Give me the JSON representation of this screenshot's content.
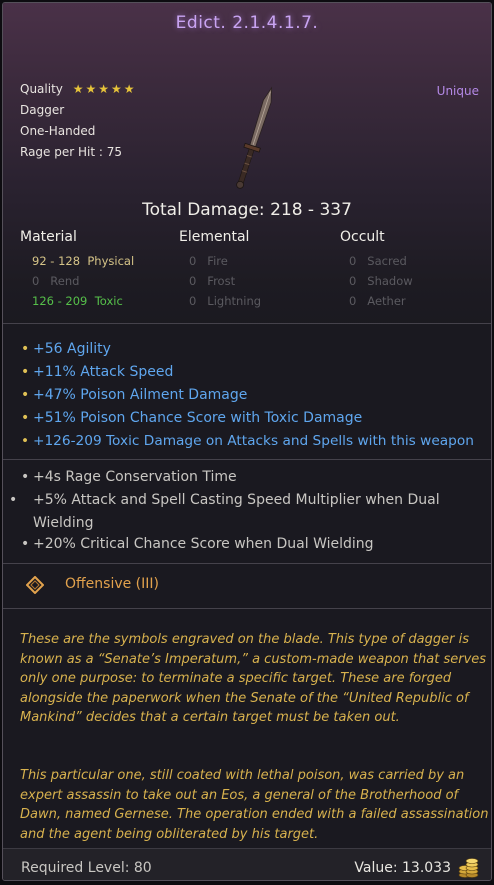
{
  "item": {
    "name": "Edict. 2.1.4.1.7.",
    "rarity": "Unique",
    "quality_label": "Quality",
    "quality_stars": "★★★★★",
    "type": "Dagger",
    "handedness": "One-Handed",
    "rage_per_hit": "Rage per Hit : 75",
    "total_damage": "Total Damage: 218 - 337"
  },
  "damage_table": {
    "headers": [
      "Material",
      "Elemental",
      "Occult"
    ],
    "rows": [
      [
        {
          "range": "92 - 128",
          "type": "Physical"
        },
        {
          "range": "0",
          "type": "Fire"
        },
        {
          "range": "0",
          "type": "Sacred"
        }
      ],
      [
        {
          "range": "0",
          "type": "Rend"
        },
        {
          "range": "0",
          "type": "Frost"
        },
        {
          "range": "0",
          "type": "Shadow"
        }
      ],
      [
        {
          "range": "126 - 209",
          "type": "Toxic"
        },
        {
          "range": "0",
          "type": "Lightning"
        },
        {
          "range": "0",
          "type": "Aether"
        }
      ]
    ]
  },
  "primary_mods": [
    "+56 Agility",
    "+11% Attack Speed",
    "+47% Poison Ailment Damage",
    "+51% Poison Chance Score with Toxic Damage",
    "+126-209 Toxic Damage on Attacks and Spells with this weapon"
  ],
  "secondary_mods": [
    "+4s Rage Conservation Time",
    "+5% Attack and Spell Casting Speed Multiplier when Dual Wielding",
    "+20% Critical Chance Score when Dual Wielding"
  ],
  "affix_category": "Offensive (III)",
  "lore": [
    "These are the symbols engraved on the blade. This type of dagger is known as a “Senate’s Imperatum,” a custom-made weapon that serves only one purpose: to terminate a specific target. These are forged alongside the paperwork when the Senate of the “United Republic of Mankind” decides that a certain target must be taken out.",
    "This particular one, still coated with lethal poison, was carried by an expert assassin to take out an Eos, a general of the Brotherhood of Dawn, named Gernese. The operation ended with a failed assassination and the agent being obliterated by his target."
  ],
  "footer": {
    "required_level": "Required Level: 80",
    "value": "Value: 13.033"
  },
  "icons": [
    "dagger-icon",
    "diamond-icon",
    "coin-stack-icon",
    "bullet-icon"
  ],
  "colors": {
    "title": "#c9a4f2",
    "rarity": "#b489e6",
    "primary_mod": "#5fa6ee",
    "toxic": "#56c04a",
    "affix": "#e2a24d",
    "lore": "#d8b24e"
  }
}
